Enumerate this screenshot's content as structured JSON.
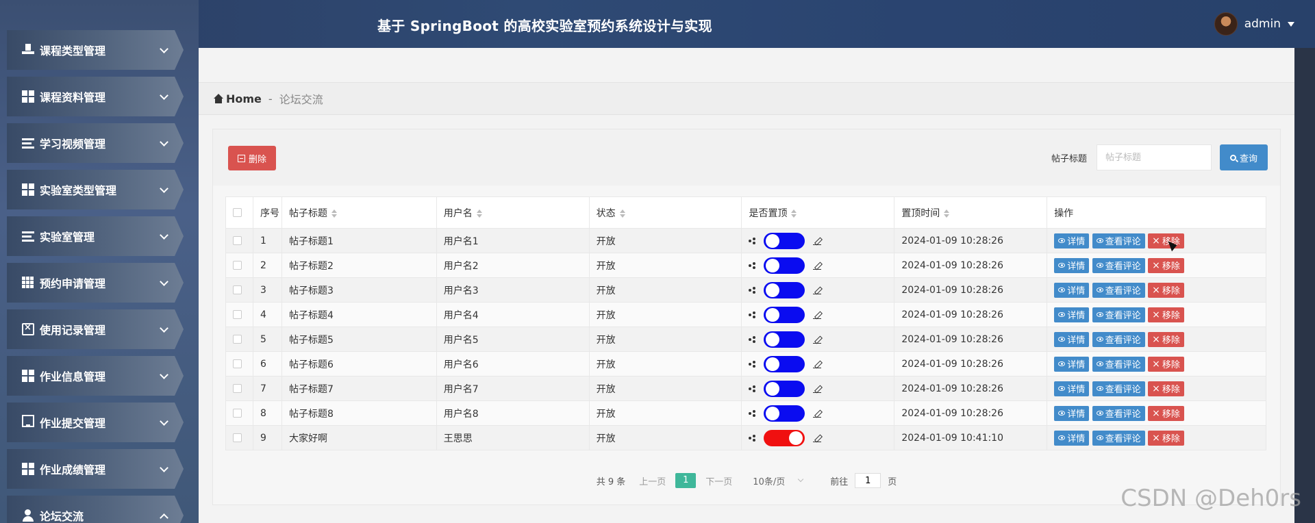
{
  "header": {
    "title": "基于 SpringBoot 的高校实验室预约系统设计与实现",
    "username": "admin"
  },
  "sidebar": {
    "items": [
      {
        "label": "课程类型管理",
        "icon": "podium-icon",
        "expanded": false
      },
      {
        "label": "课程资料管理",
        "icon": "grid-icon",
        "expanded": false
      },
      {
        "label": "学习视频管理",
        "icon": "list-icon",
        "expanded": false
      },
      {
        "label": "实验室类型管理",
        "icon": "grid-icon",
        "expanded": false
      },
      {
        "label": "实验室管理",
        "icon": "list-icon",
        "expanded": false
      },
      {
        "label": "预约申请管理",
        "icon": "ninegrid-icon",
        "expanded": false
      },
      {
        "label": "使用记录管理",
        "icon": "clipboard-icon",
        "expanded": false
      },
      {
        "label": "作业信息管理",
        "icon": "grid-icon",
        "expanded": false
      },
      {
        "label": "作业提交管理",
        "icon": "monitor-icon",
        "expanded": false
      },
      {
        "label": "作业成绩管理",
        "icon": "grid-icon",
        "expanded": false
      },
      {
        "label": "论坛交流",
        "icon": "person-icon",
        "expanded": true
      }
    ]
  },
  "breadcrumb": {
    "home": "Home",
    "separator": "-",
    "current": "论坛交流"
  },
  "toolbar": {
    "delete_label": "删除",
    "search_label": "帖子标题",
    "search_placeholder": "帖子标题",
    "search_value": "",
    "query_label": "查询"
  },
  "table": {
    "columns": [
      "序号",
      "帖子标题",
      "用户名",
      "状态",
      "是否置顶",
      "置顶时间",
      "操作"
    ],
    "rows": [
      {
        "index": "1",
        "title": "帖子标题1",
        "user": "用户名1",
        "status": "开放",
        "pinned": true,
        "time": "2024-01-09 10:28:26"
      },
      {
        "index": "2",
        "title": "帖子标题2",
        "user": "用户名2",
        "status": "开放",
        "pinned": true,
        "time": "2024-01-09 10:28:26"
      },
      {
        "index": "3",
        "title": "帖子标题3",
        "user": "用户名3",
        "status": "开放",
        "pinned": true,
        "time": "2024-01-09 10:28:26"
      },
      {
        "index": "4",
        "title": "帖子标题4",
        "user": "用户名4",
        "status": "开放",
        "pinned": true,
        "time": "2024-01-09 10:28:26"
      },
      {
        "index": "5",
        "title": "帖子标题5",
        "user": "用户名5",
        "status": "开放",
        "pinned": true,
        "time": "2024-01-09 10:28:26"
      },
      {
        "index": "6",
        "title": "帖子标题6",
        "user": "用户名6",
        "status": "开放",
        "pinned": true,
        "time": "2024-01-09 10:28:26"
      },
      {
        "index": "7",
        "title": "帖子标题7",
        "user": "用户名7",
        "status": "开放",
        "pinned": true,
        "time": "2024-01-09 10:28:26"
      },
      {
        "index": "8",
        "title": "帖子标题8",
        "user": "用户名8",
        "status": "开放",
        "pinned": true,
        "time": "2024-01-09 10:28:26"
      },
      {
        "index": "9",
        "title": "大家好啊",
        "user": "王思思",
        "status": "开放",
        "pinned": false,
        "time": "2024-01-09 10:41:10"
      }
    ],
    "actions": {
      "detail": "详情",
      "comments": "查看评论",
      "remove": "移除"
    }
  },
  "colors": {
    "toggle_on": "#0a0cf0",
    "toggle_off": "#f01010",
    "primary": "#428bca",
    "danger": "#d9534f",
    "page_active": "#3fb79a"
  },
  "pagination": {
    "total": "共 9 条",
    "prev": "上一页",
    "current_page": "1",
    "next": "下一页",
    "page_size": "10条/页",
    "goto_label": "前往",
    "goto_value": "1",
    "goto_suffix": "页"
  },
  "watermark": "CSDN @Deh0rs"
}
